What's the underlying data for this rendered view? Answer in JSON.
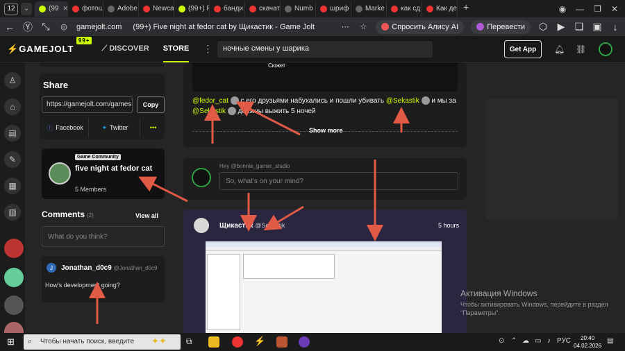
{
  "browser": {
    "tab_count": "12",
    "tabs": [
      {
        "label": "(99",
        "icon": "gamejolt-icon",
        "active": true
      },
      {
        "label": "фотош",
        "icon": "yandex-icon"
      },
      {
        "label": "Adobe",
        "icon": "doc-icon"
      },
      {
        "label": "Newca",
        "icon": "yandex-icon"
      },
      {
        "label": "(99+) F",
        "icon": "gamejolt-icon"
      },
      {
        "label": "банди",
        "icon": "yandex-icon"
      },
      {
        "label": "скачат",
        "icon": "yandex-icon"
      },
      {
        "label": "Numb",
        "icon": "doc-icon"
      },
      {
        "label": "шриф",
        "icon": "yandex-icon"
      },
      {
        "label": "Marke",
        "icon": "doc-icon"
      },
      {
        "label": "как сд",
        "icon": "yandex-icon"
      },
      {
        "label": "Как де",
        "icon": "yandex-icon"
      }
    ],
    "url": "gamejolt.com",
    "page_title": "(99+) Five night at fedor cat by Щикастик - Game Jolt",
    "ask_alice": "Спросить Алису AI",
    "translate": "Перевести"
  },
  "gj_header": {
    "logo": "GAMEJOLT",
    "badge": "99+",
    "discover": "DISCOVER",
    "store": "STORE",
    "search_value": "ночные смены у шарика",
    "get_app": "Get App"
  },
  "share": {
    "title": "Share",
    "link": "https://gamejolt.com/games",
    "copy": "Copy",
    "facebook": "Facebook",
    "twitter": "Twitter",
    "more": "•••"
  },
  "community": {
    "label": "Game Community",
    "name": "five night at fedor cat",
    "members": "5 Members"
  },
  "comments": {
    "title": "Comments",
    "count": "(2)",
    "view_all": "View all",
    "placeholder": "What do you think?",
    "items": [
      {
        "avatar": "J",
        "user": "Jonathan_d0c9",
        "handle": "@Jonathan_d0c9",
        "text": "How's development going?"
      }
    ]
  },
  "post_top": {
    "caption": "Сюжет",
    "mention1": "@fedor_cat",
    "text1": " с его друзьями набухались и пошли убивать ",
    "mention2": "@Sekastik",
    "text2": " и мы за",
    "mention3": "@Sekastik",
    "text3": " должны выжить 5 ночей",
    "show_more": "Show more"
  },
  "compose": {
    "hey": "Hey @bonnie_gamer_studio",
    "placeholder": "So, what's on your mind?"
  },
  "feed_post": {
    "author": "Щикастик",
    "handle": "@Sekastik",
    "time": "5 hours"
  },
  "windows": {
    "activate_title": "Активация Windows",
    "activate_text": "Чтобы активировать Windows, перейдите в раздел \"Параметры\".",
    "search_placeholder": "Чтобы начать поиск, введите",
    "lang": "РУС",
    "time": "20:40",
    "date": "04.02.2026"
  },
  "colors": {
    "accent": "#ccff00",
    "arrow": "#e05a45"
  }
}
